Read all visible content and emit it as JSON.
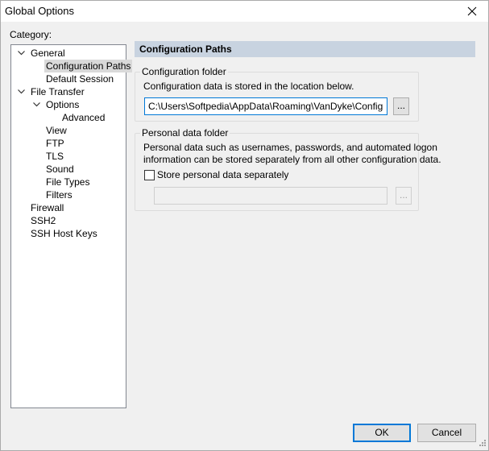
{
  "window": {
    "title": "Global Options"
  },
  "category_label": "Category:",
  "tree": [
    {
      "label": "General",
      "expanded": true
    },
    {
      "label": "Configuration Paths",
      "selected": true
    },
    {
      "label": "Default Session"
    },
    {
      "label": "File Transfer",
      "expanded": true
    },
    {
      "label": "Options",
      "expanded": true
    },
    {
      "label": "Advanced"
    },
    {
      "label": "View"
    },
    {
      "label": "FTP"
    },
    {
      "label": "TLS"
    },
    {
      "label": "Sound"
    },
    {
      "label": "File Types"
    },
    {
      "label": "Filters"
    },
    {
      "label": "Firewall"
    },
    {
      "label": "SSH2"
    },
    {
      "label": "SSH Host Keys"
    }
  ],
  "panel": {
    "header": "Configuration Paths",
    "config_folder": {
      "title": "Configuration folder",
      "description": "Configuration data is stored in the location below.",
      "path": "C:\\Users\\Softpedia\\AppData\\Roaming\\VanDyke\\Config",
      "browse_label": "..."
    },
    "personal_folder": {
      "title": "Personal data folder",
      "description_line1": "Personal data such as usernames, passwords, and automated logon",
      "description_line2": "information can be stored separately from all other configuration data.",
      "checkbox_label": "Store personal data separately",
      "checked": false,
      "path": "",
      "browse_label": "..."
    }
  },
  "buttons": {
    "ok": "OK",
    "cancel": "Cancel"
  },
  "colors": {
    "header_bg": "#c8d3e0",
    "focus": "#0078d7",
    "selected": "#d9d9d9"
  }
}
